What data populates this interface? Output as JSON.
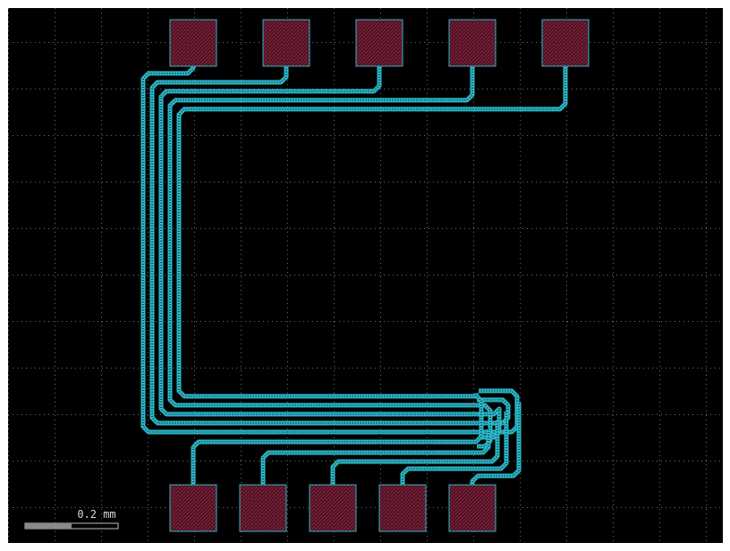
{
  "view": {
    "background": "#000000",
    "frame_color": "#ffffff",
    "grid_color": "#6e6e6e",
    "trace_color": "#2ab7c8",
    "trace_inner_color": "#0f4a55",
    "pad_fill": "#4a0f1f",
    "pad_hatch": "#8c2a45",
    "pad_outline": "#2ab7c8"
  },
  "scale_bar": {
    "label": "0.2 mm",
    "fill_fraction": 0.5,
    "bar_color": "#8a8a8a",
    "icon": "scale-bar-icon"
  },
  "pads": {
    "top_count": 5,
    "bottom_count": 5
  },
  "routes": {
    "count": 5,
    "shape": "U-bend around left side, loop on right"
  }
}
